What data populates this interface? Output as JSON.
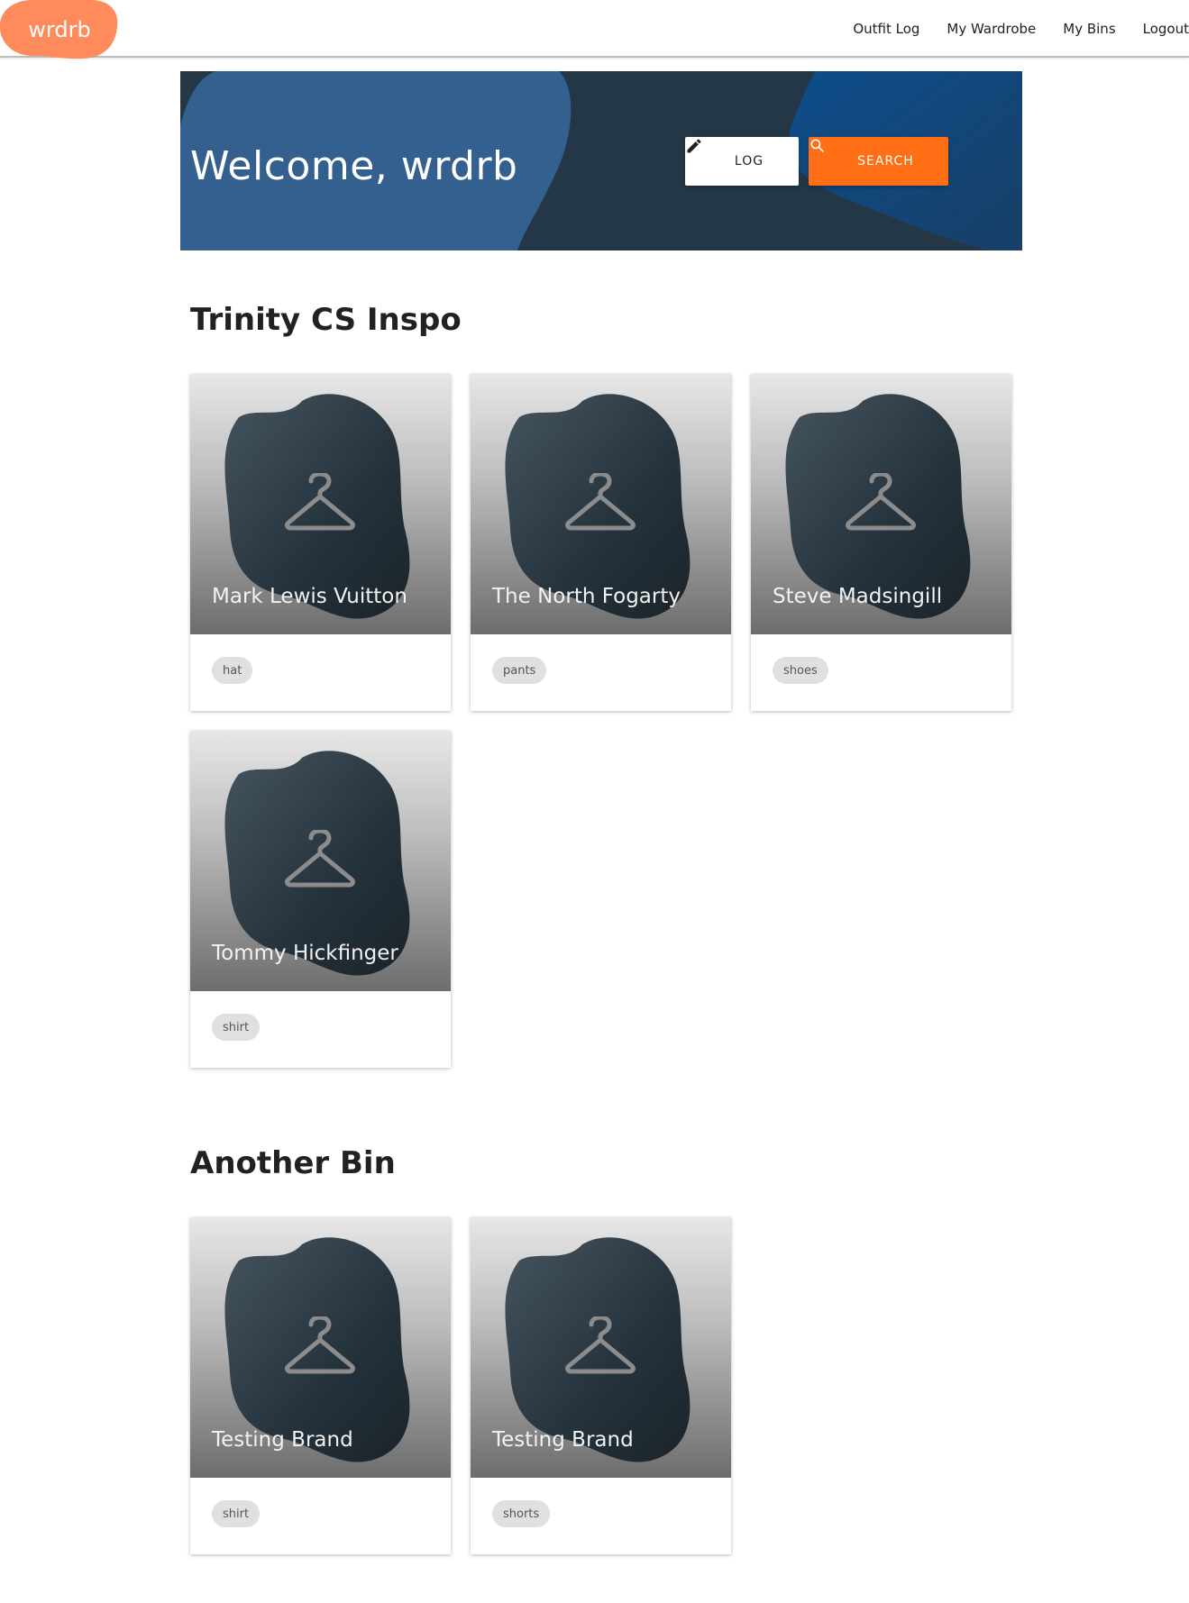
{
  "app": {
    "logo_text": "wrdrb"
  },
  "nav": {
    "items": [
      {
        "label": "Outfit Log"
      },
      {
        "label": "My Wardrobe"
      },
      {
        "label": "My Bins"
      },
      {
        "label": "Logout"
      }
    ]
  },
  "hero": {
    "title": "Welcome, wrdrb",
    "log_label": "LOG",
    "search_label": "SEARCH"
  },
  "bins": [
    {
      "title": "Trinity CS Inspo",
      "items": [
        {
          "name": "Mark Lewis Vuitton",
          "tag": "hat"
        },
        {
          "name": "The North Fogarty",
          "tag": "pants"
        },
        {
          "name": "Steve Madsingill",
          "tag": "shoes"
        },
        {
          "name": "Tommy Hickfinger",
          "tag": "shirt"
        }
      ]
    },
    {
      "title": "Another Bin",
      "items": [
        {
          "name": "Testing Brand",
          "tag": "shirt"
        },
        {
          "name": "Testing Brand",
          "tag": "shorts"
        }
      ]
    }
  ],
  "colors": {
    "accent": "#ff6e14",
    "logo": "#ff8a5b",
    "hero_bg": "#243746",
    "hero_blob": "#33608f"
  },
  "icons": [
    "pencil-icon",
    "search-icon",
    "hanger-icon"
  ]
}
